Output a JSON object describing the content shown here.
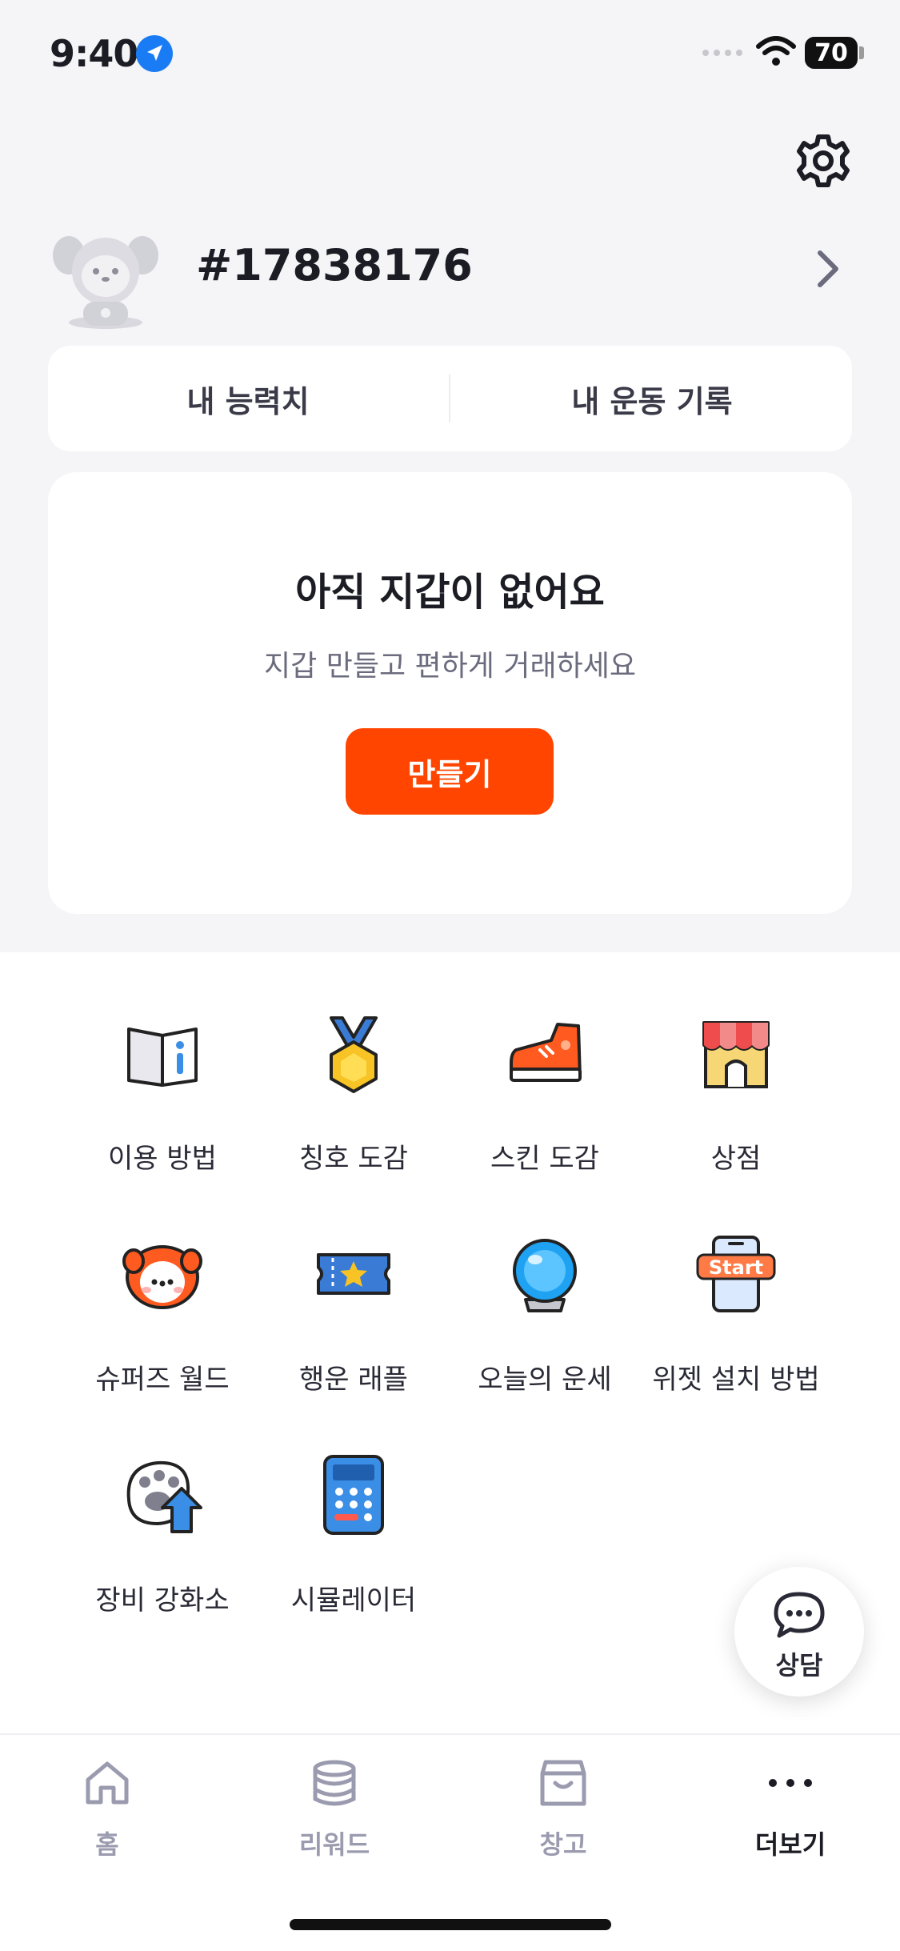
{
  "status_bar": {
    "time": "9:40",
    "battery": "70"
  },
  "profile": {
    "user_id": "#17838176"
  },
  "tabs": [
    {
      "label": "내 능력치"
    },
    {
      "label": "내 운동 기록"
    }
  ],
  "wallet": {
    "title": "아직 지갑이 없어요",
    "subtitle": "지갑 만들고 편하게 거래하세요",
    "button_label": "만들기"
  },
  "menu": [
    {
      "label": "이용 방법",
      "icon": "book-info-icon"
    },
    {
      "label": "칭호 도감",
      "icon": "medal-icon"
    },
    {
      "label": "스킨 도감",
      "icon": "sneaker-icon"
    },
    {
      "label": "상점",
      "icon": "shop-icon"
    },
    {
      "label": "슈퍼즈 월드",
      "icon": "puppy-face-icon"
    },
    {
      "label": "행운 래플",
      "icon": "ticket-icon"
    },
    {
      "label": "오늘의 운세",
      "icon": "crystal-ball-icon"
    },
    {
      "label": "위젯 설치 방법",
      "icon": "phone-start-icon"
    },
    {
      "label": "장비 강화소",
      "icon": "paw-upgrade-icon"
    },
    {
      "label": "시뮬레이터",
      "icon": "calculator-icon"
    }
  ],
  "chat_button": {
    "label": "상담"
  },
  "bottom_nav": [
    {
      "label": "홈",
      "icon": "home-icon"
    },
    {
      "label": "리워드",
      "icon": "coins-icon"
    },
    {
      "label": "창고",
      "icon": "storage-box-icon"
    },
    {
      "label": "더보기",
      "icon": "more-dots-icon"
    }
  ],
  "colors": {
    "accent": "#ff4500",
    "background": "#f5f5f8",
    "nav_inactive": "#9b9bb0"
  }
}
